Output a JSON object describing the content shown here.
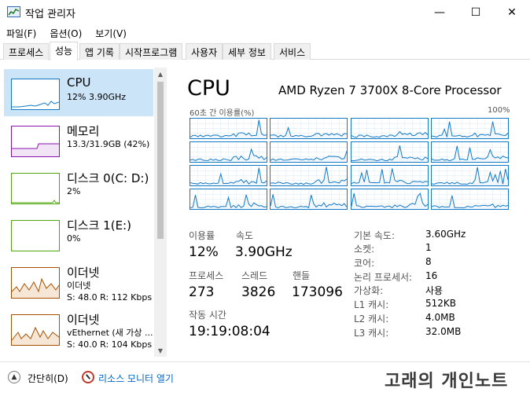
{
  "window": {
    "title": "작업 관리자",
    "minimize_glyph": "—",
    "maximize_glyph": "☐",
    "close_glyph": "✕"
  },
  "menu": [
    "파일(F)",
    "옵션(O)",
    "보기(V)"
  ],
  "tabs": [
    "프로세스",
    "성능",
    "앱 기록",
    "시작프로그램",
    "사용자",
    "세부 정보",
    "서비스"
  ],
  "active_tab": "성능",
  "sidebar": {
    "items": [
      {
        "title": "CPU",
        "sub1": "12% 3.90GHz",
        "sub2": "",
        "color": "#1279c7",
        "level": 0.12
      },
      {
        "title": "메모리",
        "sub1": "13.3/31.9GB (42%)",
        "sub2": "",
        "color": "#8b12ae",
        "level": 0.42
      },
      {
        "title": "디스크 0(C: D:)",
        "sub1": "2%",
        "sub2": "",
        "color": "#4da60c",
        "level": 0.02
      },
      {
        "title": "디스크 1(E:)",
        "sub1": "0%",
        "sub2": "",
        "color": "#4da60c",
        "level": 0.0
      },
      {
        "title": "이더넷",
        "sub1": "이더넷",
        "sub2": "S: 48.0  R: 112 Kbps",
        "color": "#a74f01",
        "level": 0.3
      },
      {
        "title": "이더넷",
        "sub1": "vEthernet (새 가상 ...",
        "sub2": "S: 40.0  R: 104 Kbps",
        "color": "#a74f01",
        "level": 0.3
      }
    ]
  },
  "cpu": {
    "title": "CPU",
    "model": "AMD Ryzen 7 3700X 8-Core Processor",
    "graph_caption": "60초 간 이용률(%)",
    "graph_max": "100%",
    "graph_color": "#1279c7",
    "stats": {
      "utilization_label": "이용률",
      "utilization": "12%",
      "speed_label": "속도",
      "speed": "3.90GHz",
      "processes_label": "프로세스",
      "processes": "273",
      "threads_label": "스레드",
      "threads": "3826",
      "handles_label": "핸들",
      "handles": "173096",
      "uptime_label": "작동 시간",
      "uptime": "19:19:08:04"
    },
    "info": [
      {
        "label": "기본 속도:",
        "value": "3.60GHz"
      },
      {
        "label": "소켓:",
        "value": "1"
      },
      {
        "label": "코어:",
        "value": "8"
      },
      {
        "label": "논리 프로세서:",
        "value": "16"
      },
      {
        "label": "가상화:",
        "value": "사용"
      },
      {
        "label": "L1 캐시:",
        "value": "512KB"
      },
      {
        "label": "L2 캐시:",
        "value": "4.0MB"
      },
      {
        "label": "L3 캐시:",
        "value": "32.0MB"
      }
    ]
  },
  "footer": {
    "fewer_details": "간단히(D)",
    "resource_monitor": "리소스 모니터 열기",
    "watermark": "고래의 개인노트"
  }
}
